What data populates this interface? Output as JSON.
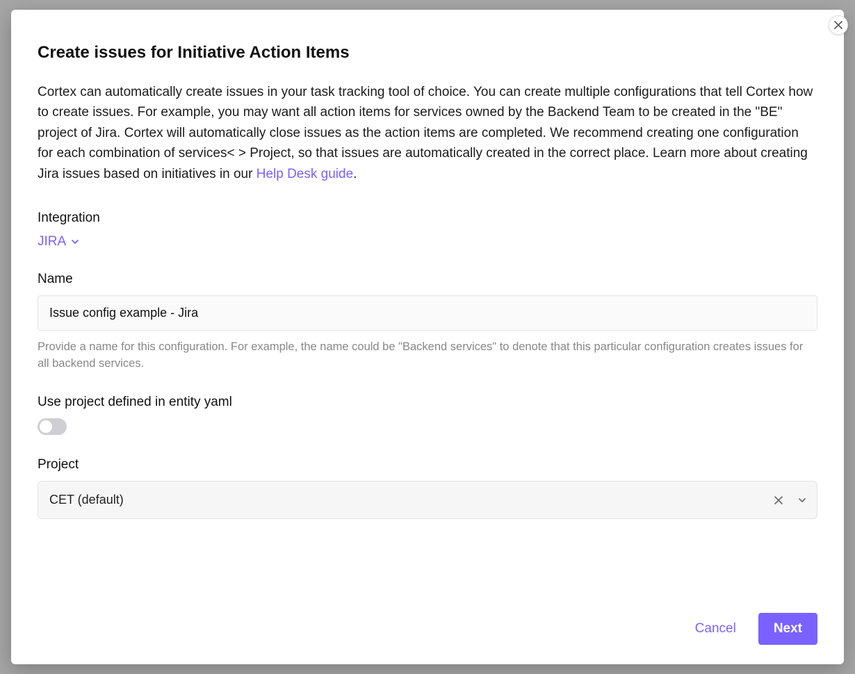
{
  "modal": {
    "title": "Create issues for Initiative Action Items",
    "description_pre": "Cortex can automatically create issues in your task tracking tool of choice. You can create multiple configurations that tell Cortex how to create issues. For example, you may want all action items for services owned by the Backend Team to be created in the \"BE\" project of Jira. Cortex will automatically close issues as the action items are completed. We recommend creating one configuration for each combination of services< > Project, so that issues are automatically created in the correct place. Learn more about creating Jira issues based on initiatives in our ",
    "description_link": "Help Desk guide",
    "description_post": "."
  },
  "integration": {
    "label": "Integration",
    "value": "JIRA"
  },
  "name": {
    "label": "Name",
    "value": "Issue config example - Jira",
    "help": "Provide a name for this configuration. For example, the name could be \"Backend services\" to denote that this particular configuration creates issues for all backend services."
  },
  "yaml_toggle": {
    "label": "Use project defined in entity yaml",
    "on": false
  },
  "project": {
    "label": "Project",
    "value": "CET (default)"
  },
  "footer": {
    "cancel": "Cancel",
    "next": "Next"
  }
}
